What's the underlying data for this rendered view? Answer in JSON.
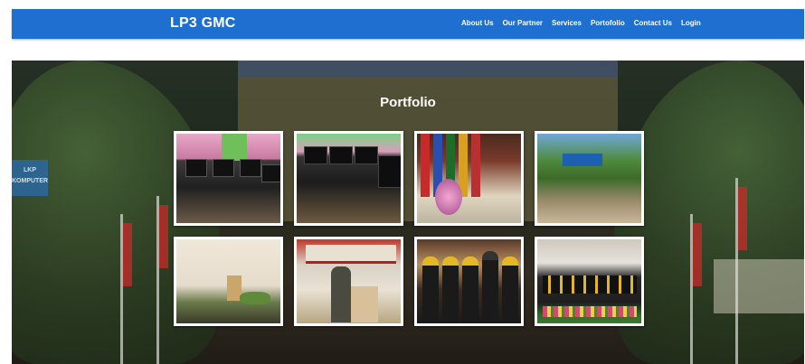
{
  "navbar": {
    "brand": "LP3 GMC",
    "links": [
      "About Us",
      "Our Partner",
      "Services",
      "Portofolio",
      "Contact Us",
      "Login"
    ],
    "background_color": "#1f6fd1"
  },
  "hero": {
    "title": "Portfolio",
    "background_sign_text": "LKP\nKOMPUTER",
    "photos": [
      {
        "subject": "computer-lab-1"
      },
      {
        "subject": "computer-lab-2"
      },
      {
        "subject": "flags-and-flowers"
      },
      {
        "subject": "building-exterior"
      },
      {
        "subject": "speaker-at-podium"
      },
      {
        "subject": "speech-ceremony"
      },
      {
        "subject": "graduation-handshake"
      },
      {
        "subject": "graduation-group"
      }
    ]
  }
}
